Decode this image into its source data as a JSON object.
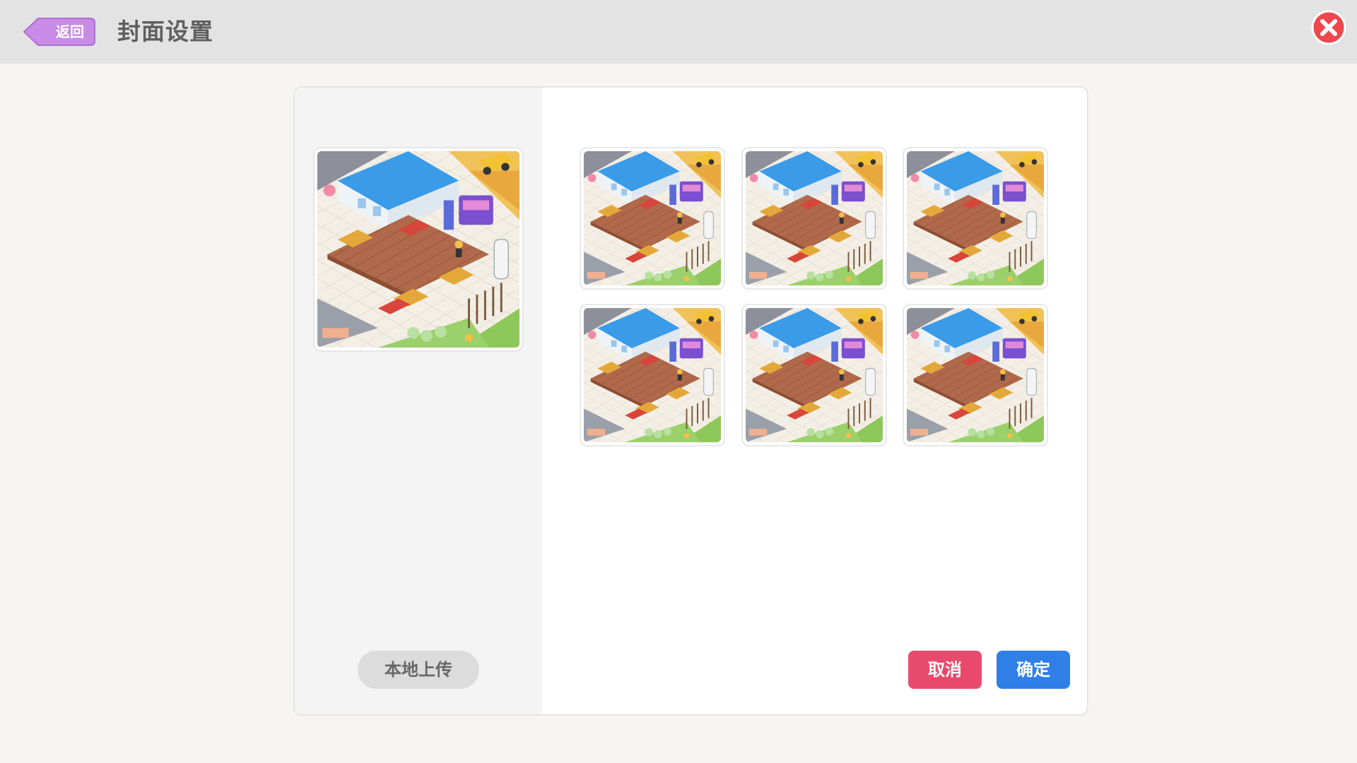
{
  "header": {
    "back_label": "返回",
    "title": "封面设置",
    "close_icon": "close-icon"
  },
  "dialog": {
    "upload_label": "本地上传",
    "cancel_label": "取消",
    "confirm_label": "确定",
    "cover_options": [
      {
        "name": "cover-option-1"
      },
      {
        "name": "cover-option-2"
      },
      {
        "name": "cover-option-3"
      },
      {
        "name": "cover-option-4"
      },
      {
        "name": "cover-option-5"
      },
      {
        "name": "cover-option-6"
      }
    ]
  },
  "colors": {
    "back_button": "#c98ce6",
    "close_button": "#f0474f",
    "cancel_button": "#e84a6e",
    "confirm_button": "#2f7fe6",
    "upload_button": "#dcdcdc"
  }
}
